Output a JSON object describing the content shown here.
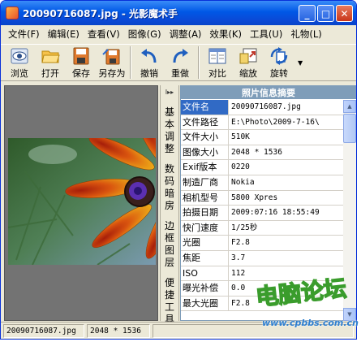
{
  "window": {
    "title": "20090716087.jpg - 光影魔术手"
  },
  "menu": [
    {
      "label": "文件(F)"
    },
    {
      "label": "编辑(E)"
    },
    {
      "label": "查看(V)"
    },
    {
      "label": "图像(G)"
    },
    {
      "label": "调整(A)"
    },
    {
      "label": "效果(K)"
    },
    {
      "label": "工具(U)"
    },
    {
      "label": "礼物(L)"
    }
  ],
  "toolbar": {
    "tools": [
      {
        "label": "浏览",
        "icon": "eye-icon"
      },
      {
        "label": "打开",
        "icon": "folder-open-icon"
      },
      {
        "label": "保存",
        "icon": "save-icon"
      },
      {
        "label": "另存为",
        "icon": "save-as-icon"
      },
      {
        "label": "撤销",
        "icon": "undo-icon"
      },
      {
        "label": "重做",
        "icon": "redo-icon"
      },
      {
        "label": "对比",
        "icon": "compare-icon"
      },
      {
        "label": "缩放",
        "icon": "zoom-icon"
      },
      {
        "label": "旋转",
        "icon": "rotate-icon"
      }
    ]
  },
  "side_tabs": {
    "arrows": "I▸▸",
    "tabs": [
      {
        "label": "基本调整"
      },
      {
        "label": "数码暗房"
      },
      {
        "label": "边框图层"
      },
      {
        "label": "便捷工具"
      }
    ]
  },
  "info_panel": {
    "title": "照片信息摘要",
    "rows": [
      {
        "key": "文件名",
        "value": "20090716087.jpg"
      },
      {
        "key": "文件路径",
        "value": "E:\\Photo\\2009-7-16\\"
      },
      {
        "key": "文件大小",
        "value": "510K"
      },
      {
        "key": "图像大小",
        "value": "2048 * 1536"
      },
      {
        "key": "Exif版本",
        "value": "0220"
      },
      {
        "key": "制造厂商",
        "value": "Nokia"
      },
      {
        "key": "相机型号",
        "value": "5800 Xpres"
      },
      {
        "key": "拍摄日期",
        "value": "2009:07:16 18:55:49"
      },
      {
        "key": "快门速度",
        "value": "1/25秒"
      },
      {
        "key": "光圈",
        "value": "F2.8"
      },
      {
        "key": "焦距",
        "value": "3.7"
      },
      {
        "key": "ISO",
        "value": "112"
      },
      {
        "key": "曝光补偿",
        "value": "0.0"
      },
      {
        "key": "最大光圈",
        "value": "F2.8"
      }
    ]
  },
  "status": {
    "filename": "20090716087.jpg",
    "dimensions": "2048 * 1536"
  },
  "watermark": {
    "text": "电脑论坛",
    "url": "www.cpbbs.com.cn"
  }
}
